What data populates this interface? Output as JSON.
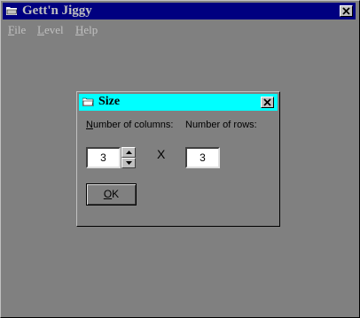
{
  "window": {
    "title": "Gett'n Jiggy",
    "close_glyph": "✕",
    "icon": "app-folder-icon",
    "title_color": "#000080"
  },
  "menubar": {
    "items": [
      {
        "label": "File",
        "mnemonic": "F",
        "rest": "ile"
      },
      {
        "label": "Level",
        "mnemonic": "L",
        "rest": "evel"
      },
      {
        "label": "Help",
        "mnemonic": "H",
        "rest": "elp"
      }
    ]
  },
  "dialog": {
    "title": "Size",
    "title_color": "#00ffff",
    "columns_label": {
      "mnemonic": "N",
      "rest": "umber of columns:"
    },
    "rows_label": "Number of rows:",
    "columns_value": "3",
    "rows_value": "3",
    "times_symbol": "X",
    "ok": {
      "mnemonic": "O",
      "rest": "K"
    }
  }
}
